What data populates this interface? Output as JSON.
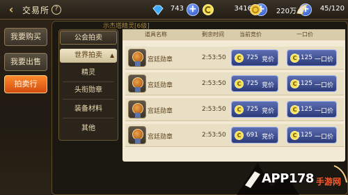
{
  "header": {
    "back_icon": "back-arrow-icon",
    "title": "交易所",
    "help_icon": "question-circle-icon",
    "currencies": [
      {
        "icon": "diamond-icon",
        "value": "743"
      },
      {
        "icon": "c-coin-icon",
        "value": "3416"
      },
      {
        "icon": "gold-coin-icon",
        "value": "220万"
      },
      {
        "icon": "stamina-wing-icon",
        "value": "45/120"
      }
    ]
  },
  "side_tabs": [
    {
      "label": "我要购买",
      "active": false
    },
    {
      "label": "我要出售",
      "active": false
    },
    {
      "label": "拍卖行",
      "active": true
    }
  ],
  "banner": "示杰塔精灵[6级]",
  "categories": {
    "guild": "公会拍卖",
    "world": "世界拍卖",
    "items": [
      "精灵",
      "头衔勋章",
      "装备材料",
      "其他"
    ]
  },
  "table": {
    "headers": [
      "道具名称",
      "剩余时间",
      "当前竞价",
      "一口价"
    ],
    "bid_label": "竞价",
    "buy_label": "一口价",
    "coin_symbol": "C",
    "rows": [
      {
        "name": "宫廷勋章",
        "time": "2:53:50",
        "bid": "725",
        "buyout": "1125"
      },
      {
        "name": "宫廷勋章",
        "time": "2:53:50",
        "bid": "725",
        "buyout": "1125"
      },
      {
        "name": "宫廷勋章",
        "time": "2:53:50",
        "bid": "725",
        "buyout": "1125"
      },
      {
        "name": "宫廷勋章",
        "time": "2:53:50",
        "bid": "691",
        "buyout": "1125"
      }
    ]
  },
  "watermark": {
    "main": "APP178",
    "sub": "手游网"
  }
}
